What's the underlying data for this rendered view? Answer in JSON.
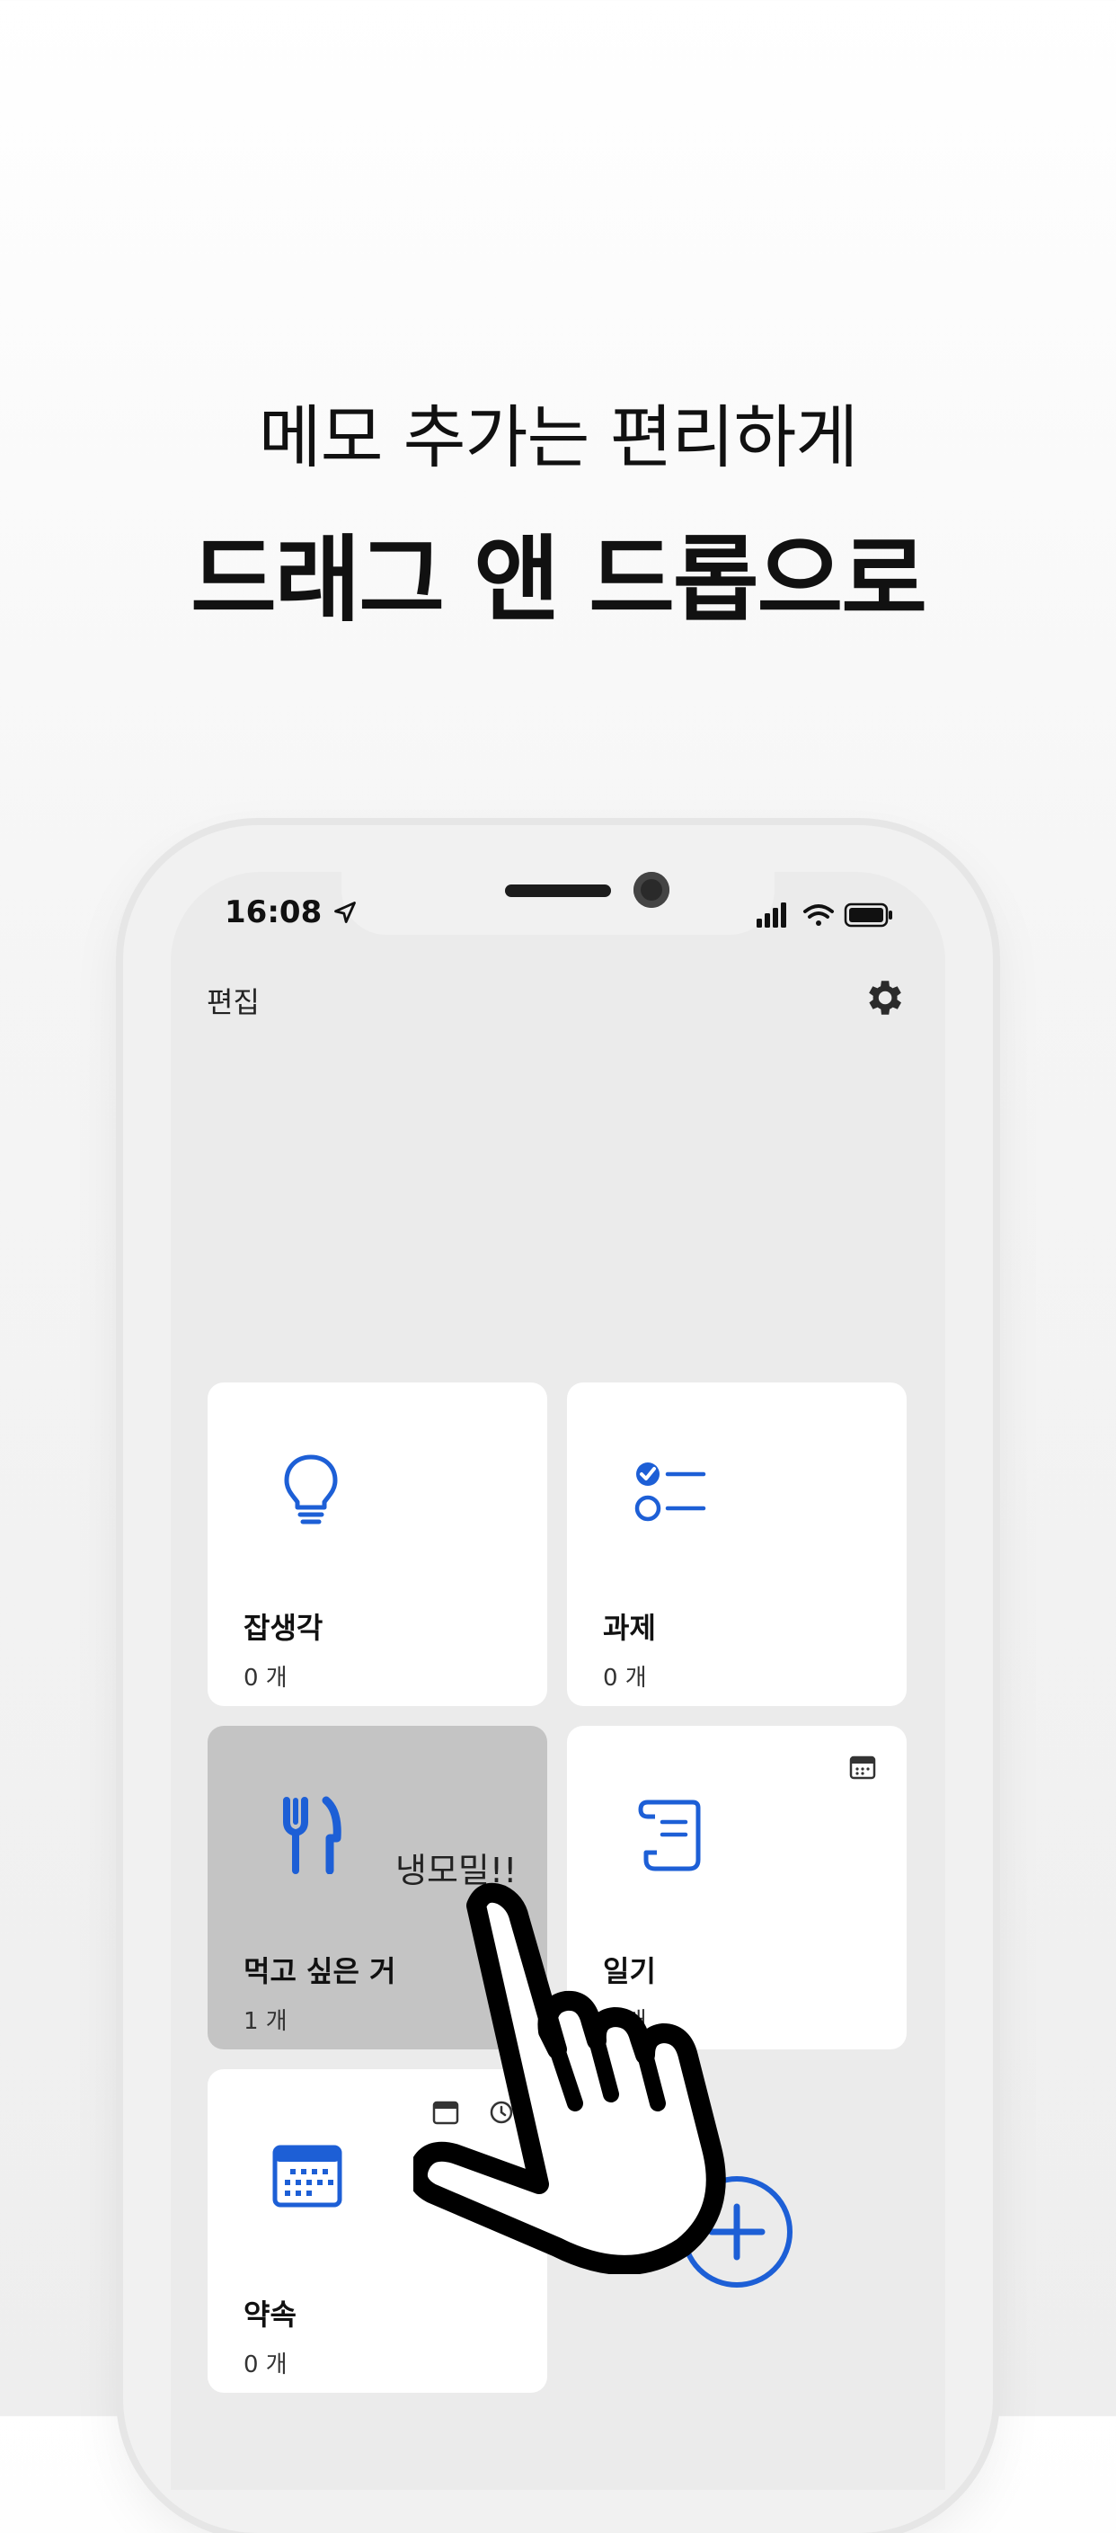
{
  "headline": {
    "line1": "메모 추가는 편리하게",
    "line2": "드래그 앤 드롭으로"
  },
  "status_bar": {
    "time": "16:08",
    "icons": [
      "location-arrow-icon",
      "signal-icon",
      "wifi-icon",
      "battery-icon"
    ]
  },
  "top_bar": {
    "edit_label": "편집",
    "settings_icon": "gear-icon"
  },
  "categories": [
    {
      "title": "잡생각",
      "count": "0 개",
      "icon": "lightbulb-icon"
    },
    {
      "title": "과제",
      "count": "0 개",
      "icon": "checklist-icon"
    },
    {
      "title": "먹고 싶은 거",
      "count": "1 개",
      "icon": "fork-knife-icon"
    },
    {
      "title": "일기",
      "count": "0 개",
      "icon": "scroll-icon"
    },
    {
      "title": "약속",
      "count": "0 개",
      "icon": "calendar-icon"
    }
  ],
  "drag_memo": "냉모밀!!",
  "fab_icon": "plus-icon",
  "colors": {
    "accent": "#1d5fd6",
    "screen_bg": "#ebebeb",
    "card_bg": "#ffffff",
    "drag_card_bg": "#c4c4c4"
  }
}
